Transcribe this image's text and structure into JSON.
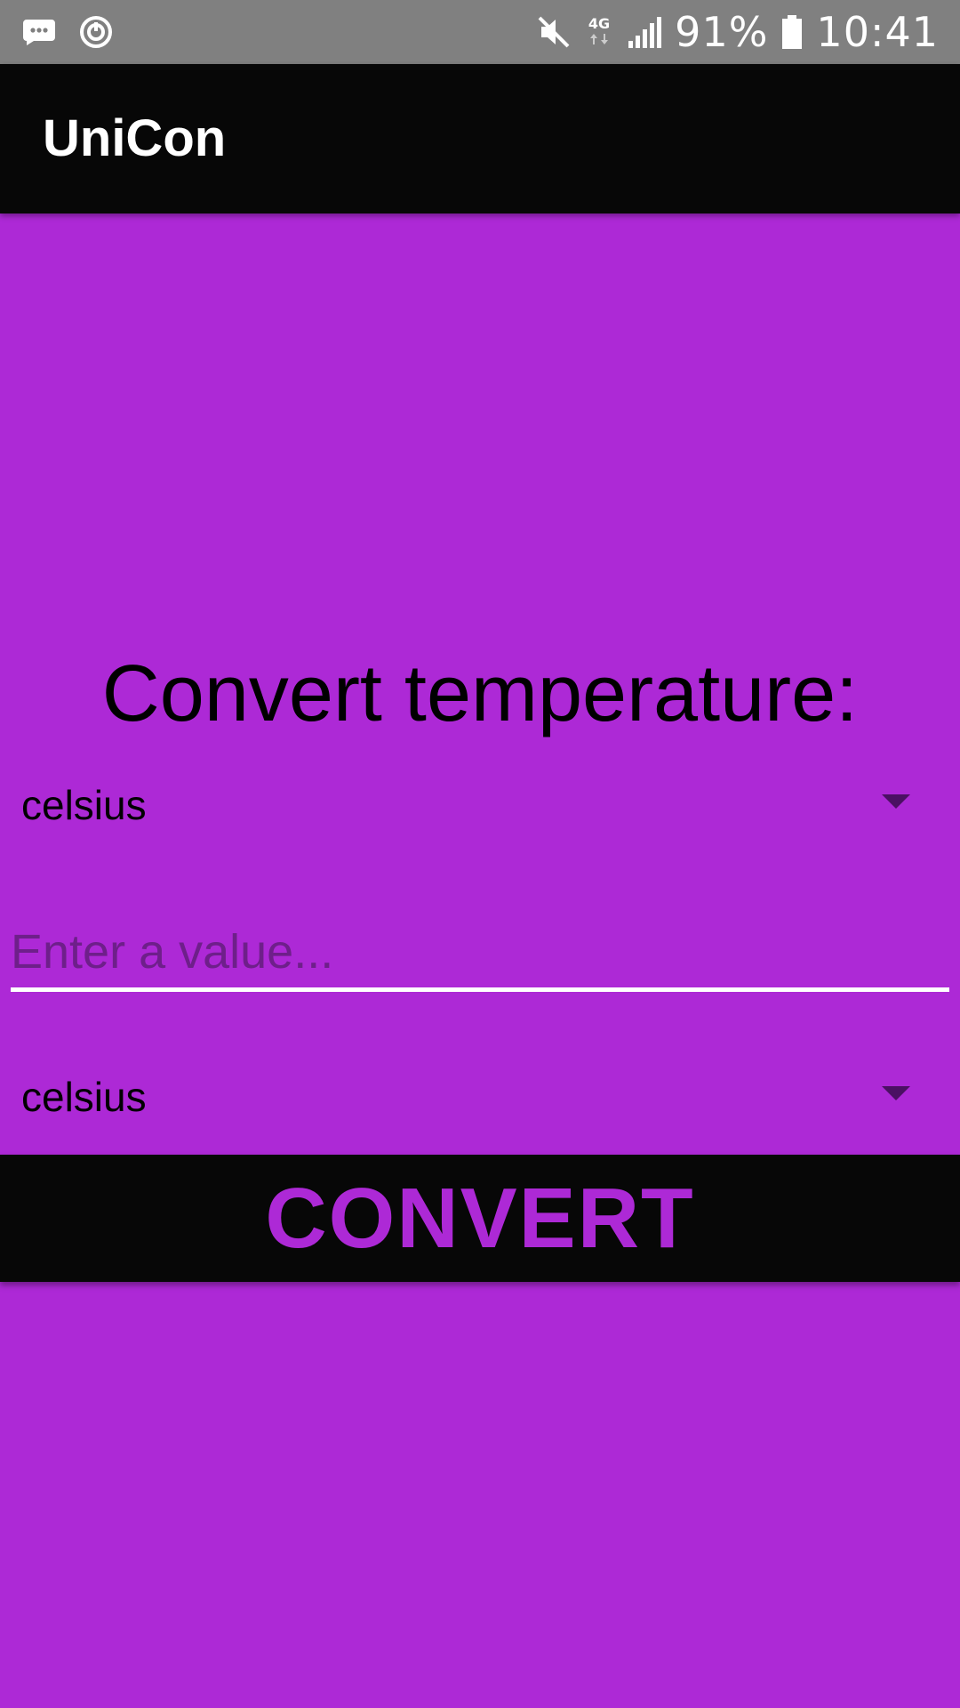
{
  "status_bar": {
    "battery_percent": "91%",
    "network_type": "4G",
    "time": "10:41",
    "icons": [
      "message-icon",
      "sync-icon",
      "mute-icon",
      "network-4g-icon",
      "signal-icon",
      "battery-icon"
    ]
  },
  "app_bar": {
    "title": "UniCon"
  },
  "main": {
    "heading": "Convert temperature:",
    "from_unit": {
      "selected": "celsius"
    },
    "input": {
      "value": "",
      "placeholder": "Enter a value..."
    },
    "to_unit": {
      "selected": "celsius"
    },
    "convert_label": "CONVERT"
  },
  "colors": {
    "background": "#AD29D6",
    "app_bar": "#070707",
    "status_bar": "#808080",
    "button_text": "#AD29D6",
    "input_underline": "#FFFFFF"
  }
}
